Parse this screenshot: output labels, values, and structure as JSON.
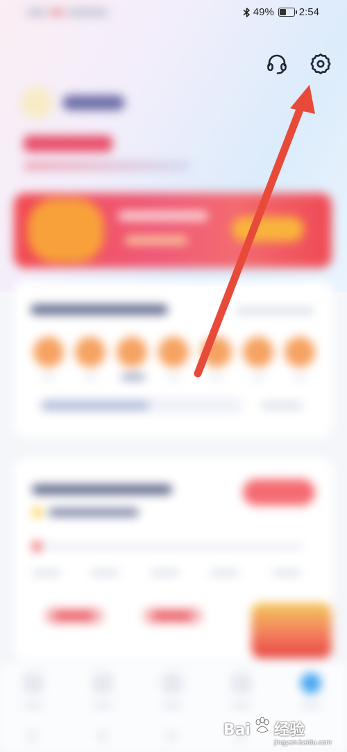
{
  "status_bar": {
    "bluetooth_icon": "bluetooth-icon",
    "battery_percent": "49%",
    "battery_level": 0.49,
    "time": "2:54"
  },
  "header_icons": {
    "support": "headset-icon",
    "settings": "gear-icon"
  },
  "annotation": {
    "arrow_color": "#e84a3a",
    "points_to": "settings"
  },
  "watermark": {
    "brand": "Bai",
    "brand_suffix": "经验",
    "sub": "jingyan.baidu.com"
  },
  "colors": {
    "banner_red": "#f14a52",
    "accent_orange": "#f6a261",
    "active_tab_blue": "#49a7f0"
  }
}
